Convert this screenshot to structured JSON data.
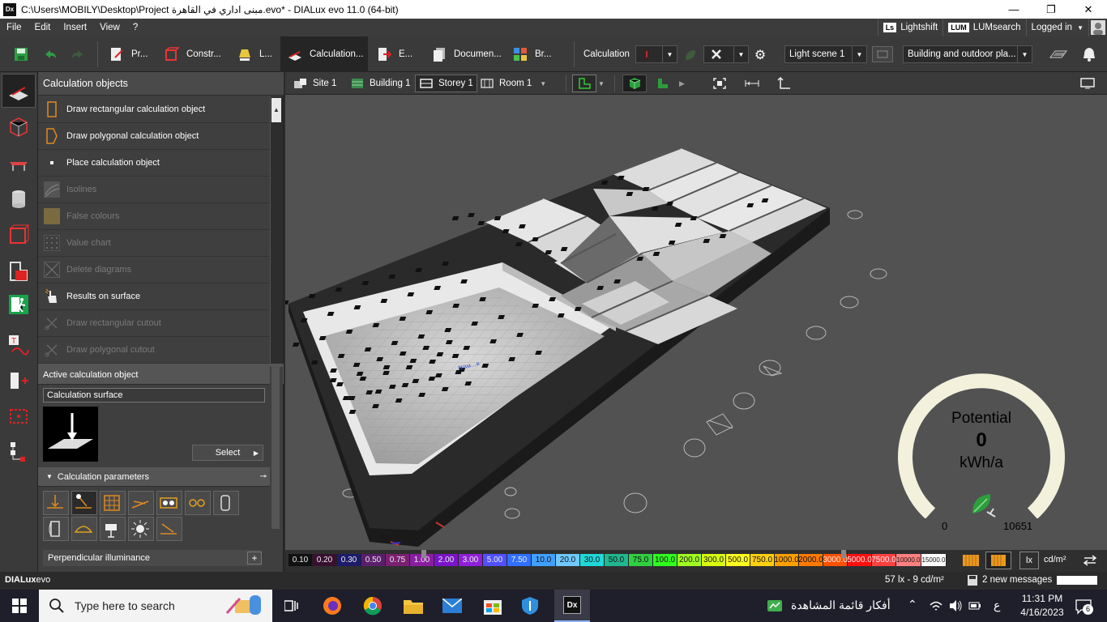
{
  "window": {
    "app_icon": "Dx",
    "title": "C:\\Users\\MOBILY\\Desktop\\Project مبنى اداري في القاهرة.evo* - DIALux evo 11.0  (64-bit)",
    "minimize": "—",
    "restore": "❐",
    "close": "✕"
  },
  "menu": {
    "items": [
      "File",
      "Edit",
      "Insert",
      "View",
      "?"
    ],
    "lightshift": "Lightshift",
    "lightshift_badge": "Ls",
    "lumsearch": "LUMsearch",
    "lumsearch_badge": "LUM",
    "logged_in": "Logged in"
  },
  "toolbar": {
    "tabs": [
      "Pr...",
      "Constr...",
      "L...",
      "Calculation...",
      "E...",
      "Documen...",
      "Br..."
    ],
    "calculation_label": "Calculation",
    "light_scene": "Light scene 1",
    "output_mode": "Building and outdoor pla..."
  },
  "panel": {
    "header": "Calculation objects",
    "items": [
      {
        "label": "Draw rectangular calculation object",
        "enabled": true,
        "icon": "rectangle-calc-icon"
      },
      {
        "label": "Draw polygonal calculation object",
        "enabled": true,
        "icon": "polygon-calc-icon"
      },
      {
        "label": "Place calculation object",
        "enabled": true,
        "icon": "point-icon"
      },
      {
        "label": "Isolines",
        "enabled": false,
        "icon": "isolines-icon"
      },
      {
        "label": "False colours",
        "enabled": false,
        "icon": "false-colours-icon"
      },
      {
        "label": "Value chart",
        "enabled": false,
        "icon": "value-chart-icon"
      },
      {
        "label": "Delete diagrams",
        "enabled": false,
        "icon": "delete-diagrams-icon"
      },
      {
        "label": "Results on surface",
        "enabled": true,
        "icon": "hand-pointer-icon"
      },
      {
        "label": "Draw rectangular cutout",
        "enabled": false,
        "icon": "cutout-icon"
      },
      {
        "label": "Draw polygonal cutout",
        "enabled": false,
        "icon": "cutout-icon"
      }
    ],
    "active_header": "Active calculation object",
    "active_object": "Calculation surface",
    "select_label": "Select",
    "params_header": "Calculation parameters",
    "perpendicular": "Perpendicular illuminance"
  },
  "viewport": {
    "breadcrumbs": [
      "Site 1",
      "Building 1",
      "Storey 1",
      "Room 1"
    ],
    "gauge": {
      "title": "Potential",
      "value": "0",
      "unit": "kWh/a",
      "min": "0",
      "max": "10651",
      "level": 0.0
    }
  },
  "legend": {
    "values": [
      "0.10",
      "0.20",
      "0.30",
      "0.50",
      "0.75",
      "1.00",
      "2.00",
      "3.00",
      "5.00",
      "7.50",
      "10.0",
      "20.0",
      "30.0",
      "50.0",
      "75.0",
      "100.0",
      "200.0",
      "300.0",
      "500.0",
      "750.0",
      "1000.0",
      "2000.0",
      "3000.0",
      "5000.0",
      "7500.0",
      "10000.0",
      "15000.0"
    ],
    "colors": [
      "#111111",
      "#3a1030",
      "#1c1c6a",
      "#5a1e6a",
      "#7a2070",
      "#8a1ea0",
      "#7a14c8",
      "#9020d8",
      "#5050ff",
      "#3070ff",
      "#40a0ff",
      "#70c8ff",
      "#20d8d8",
      "#20b890",
      "#30d040",
      "#30ff20",
      "#a0ff20",
      "#d8ff10",
      "#ffff20",
      "#ffd010",
      "#ffa000",
      "#ff7a00",
      "#ff5000",
      "#ff1010",
      "#ff4040",
      "#ff8080",
      "#ffffff"
    ],
    "unit_lx": "lx",
    "unit_cd": "cd/m²"
  },
  "status": {
    "app_name_bold": "DIALux",
    "app_name_rest": "evo",
    "readout": "57 lx - 9 cd/m²",
    "messages": "2 new messages"
  },
  "taskbar": {
    "search_placeholder": "Type here to search",
    "news": "أفكار قائمة المشاهدة",
    "lang": "ع",
    "time": "11:31 PM",
    "date": "4/16/2023",
    "notifications": "6"
  }
}
